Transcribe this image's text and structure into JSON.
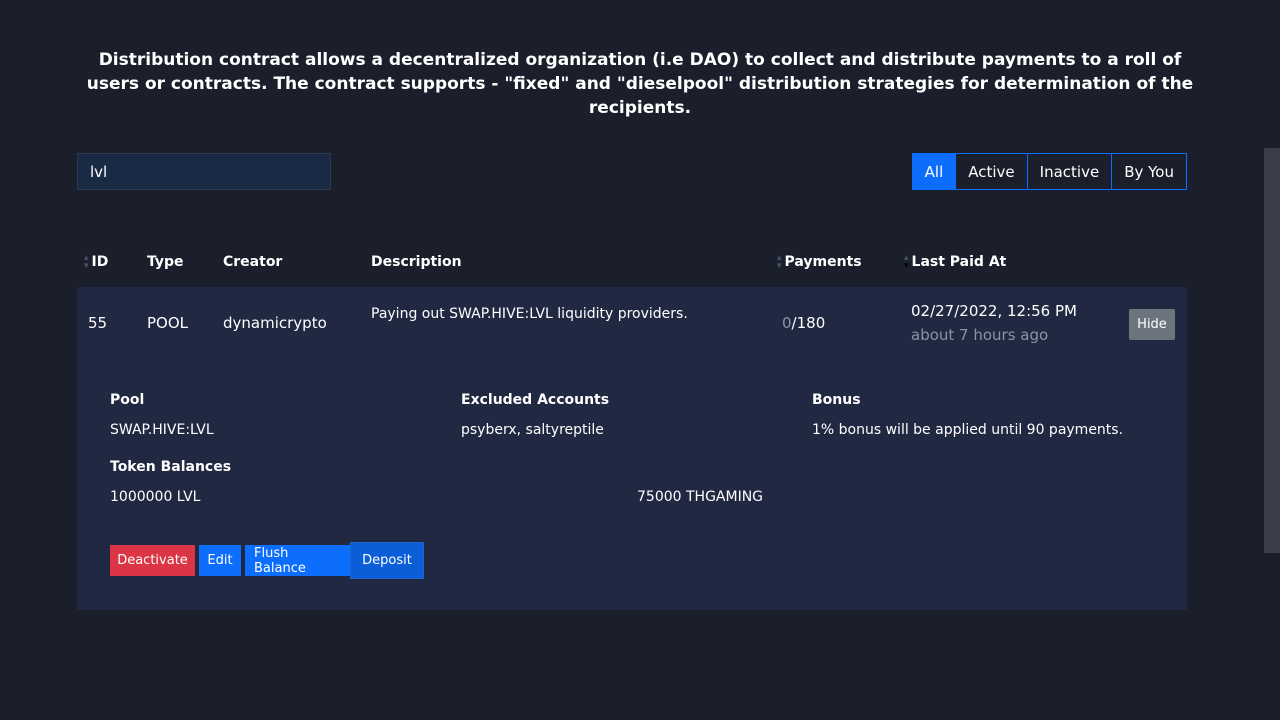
{
  "intro": "Distribution contract allows a decentralized organization (i.e DAO) to collect and distribute payments to a roll of users or contracts. The contract supports - \"fixed\" and \"dieselpool\" distribution strategies for determination of the recipients.",
  "search": {
    "value": "lvl"
  },
  "filters": [
    "All",
    "Active",
    "Inactive",
    "By You"
  ],
  "headers": {
    "id": "ID",
    "type": "Type",
    "creator": "Creator",
    "description": "Description",
    "payments": "Payments",
    "last_paid": "Last Paid At"
  },
  "row": {
    "id": "55",
    "type": "POOL",
    "creator": "dynamicrypto",
    "description": "Paying out SWAP.HIVE:LVL liquidity providers.",
    "payments_done": "0",
    "payments_total": "/180",
    "last_paid": "02/27/2022, 12:56 PM",
    "last_paid_relative": "about 7 hours ago",
    "hide_label": "Hide"
  },
  "details": {
    "pool_label": "Pool",
    "pool_value": "SWAP.HIVE:LVL",
    "excluded_label": "Excluded Accounts",
    "excluded_value": "psyberx, saltyreptile",
    "bonus_label": "Bonus",
    "bonus_value": "1% bonus will be applied until 90 payments.",
    "balances_label": "Token Balances",
    "balances": [
      "1000000 LVL",
      "75000 THGAMING"
    ]
  },
  "actions": {
    "deactivate": "Deactivate",
    "edit": "Edit",
    "flush": "Flush Balance",
    "deposit": "Deposit"
  },
  "colors": {
    "background": "#1b1f2b",
    "card": "#212942",
    "primary": "#0d6efd",
    "danger": "#dc3545",
    "secondary": "#6c757d"
  }
}
